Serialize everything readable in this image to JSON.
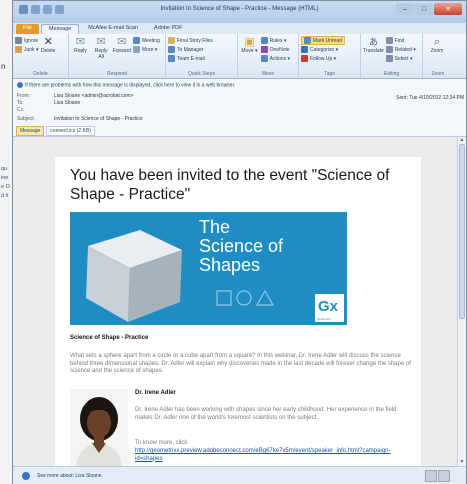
{
  "background_window": {
    "lines": [
      "n",
      "qu",
      "ine",
      "e O",
      "d li"
    ]
  },
  "window": {
    "title": "Invitation to Science of Shape - Practice - Message (HTML)",
    "min": "–",
    "max": "□",
    "close": "✕"
  },
  "tabs": [
    "File",
    "Message",
    "McAfee E-mail Scan",
    "Adobe PDF"
  ],
  "ribbon": {
    "delete_group": {
      "label": "Delete",
      "ignore": "Ignore",
      "junk": "Junk ▾",
      "delete": "Delete"
    },
    "respond_group": {
      "label": "Respond",
      "reply": "Reply",
      "reply_all": "Reply All",
      "forward": "Forward",
      "meeting": "Meeting",
      "more": "More ▾"
    },
    "quick_steps": {
      "label": "Quick Steps",
      "items": [
        "Final Story Files",
        "To Manager",
        "Team E-mail"
      ]
    },
    "move_group": {
      "label": "Move",
      "move": "Move ▾",
      "rules": "Rules ▾",
      "onenote": "OneNote",
      "actions": "Actions ▾"
    },
    "tags_group": {
      "label": "Tags",
      "mark_unread": "Mark Unread",
      "categorize": "Categorize ▾",
      "follow_up": "Follow Up ▾"
    },
    "editing_group": {
      "label": "Editing",
      "translate": "Translate",
      "find": "Find",
      "related": "Related ▾",
      "select": "Select ▾"
    },
    "zoom_group": {
      "label": "Zoom",
      "zoom": "Zoom"
    }
  },
  "message": {
    "infobar": "If there are problems with how this message is displayed, click here to view it in a web browser.",
    "from_label": "From:",
    "from": "Lisa Sloane <admin@acrobat.com>",
    "to_label": "To:",
    "to": "Lisa Sloane",
    "cc_label": "Cc:",
    "cc": "",
    "subject_label": "Subject:",
    "subject": "Invitation to Science of Shape - Practice",
    "sent": "Sent:  Tue 4/10/2012 12:34 PM",
    "attachments": [
      "Message",
      "connect.ics (2 KB)"
    ]
  },
  "email": {
    "headline": "You have been invited to the event \"Science of Shape - Practice\"",
    "banner_text": [
      "The",
      "Science of",
      "Shapes"
    ],
    "banner_logo": "Gx",
    "banner_logo_sub": "Geometrix",
    "subtitle": "Science of Shape - Practice",
    "description": "What sets a sphere apart from a circle or a cube apart from a square? In this webinar, Dr. Irene Adler will discuss the science behind three dimensional shapes. Dr. Adler will explain why discoveries made in the last decade will forever change the shape of science and the science of shapes.",
    "speaker_name": "Dr. Irene Adler",
    "speaker_bio": "Dr. Irene Adler has been working with shapes since her early childhood. Her experience in the field makes Dr. Adler one of the world's foremost scientists on the subject.",
    "know_more": "To know more, click",
    "link": "http://geometrixx.preview.adobeconnect.com/eBg67ke7v5m/event/speaker_info.html?campaign-id=shapes"
  },
  "people_pane": {
    "text": "See more about: Lisa Sloane."
  },
  "colors": {
    "banner": "#1e8dc4",
    "file_tab": "#e39c2c",
    "link": "#1a4dbf"
  }
}
